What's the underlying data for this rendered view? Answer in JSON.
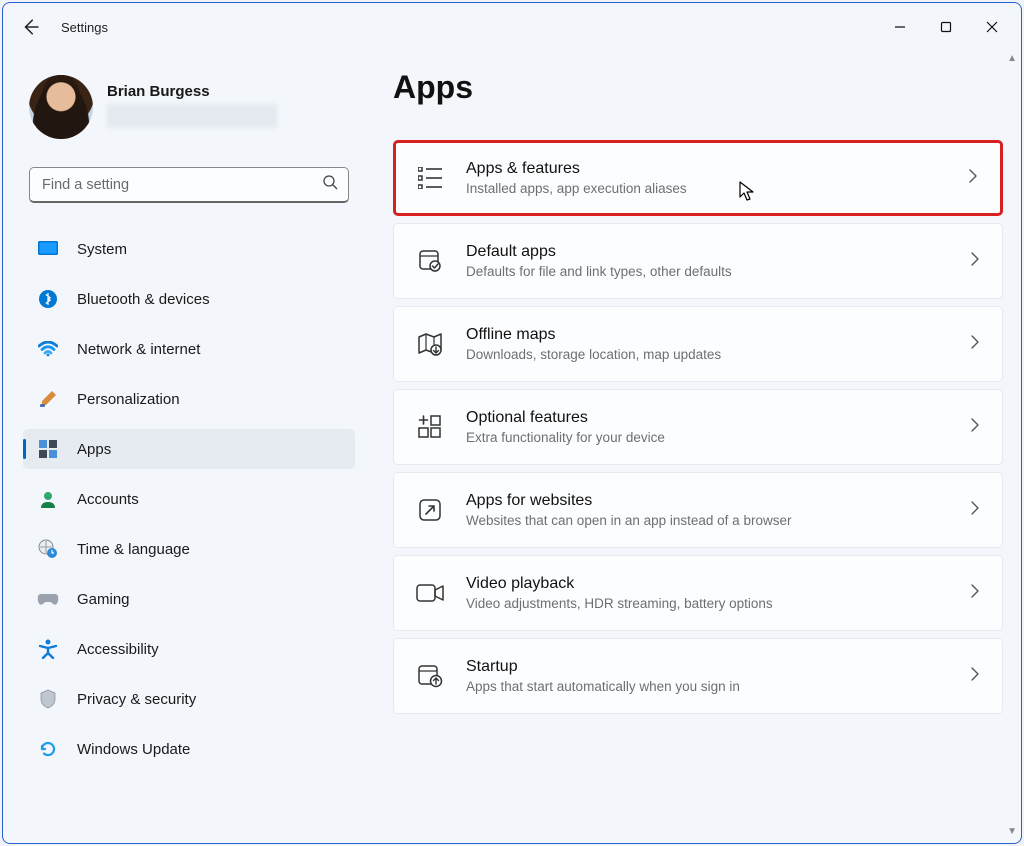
{
  "window": {
    "app_title": "Settings"
  },
  "profile": {
    "name": "Brian Burgess"
  },
  "search": {
    "placeholder": "Find a setting"
  },
  "sidebar": {
    "items": [
      {
        "label": "System"
      },
      {
        "label": "Bluetooth & devices"
      },
      {
        "label": "Network & internet"
      },
      {
        "label": "Personalization"
      },
      {
        "label": "Apps"
      },
      {
        "label": "Accounts"
      },
      {
        "label": "Time & language"
      },
      {
        "label": "Gaming"
      },
      {
        "label": "Accessibility"
      },
      {
        "label": "Privacy & security"
      },
      {
        "label": "Windows Update"
      }
    ],
    "selected_index": 4
  },
  "page": {
    "heading": "Apps",
    "cards": [
      {
        "title": "Apps & features",
        "sub": "Installed apps, app execution aliases",
        "highlighted": true
      },
      {
        "title": "Default apps",
        "sub": "Defaults for file and link types, other defaults"
      },
      {
        "title": "Offline maps",
        "sub": "Downloads, storage location, map updates"
      },
      {
        "title": "Optional features",
        "sub": "Extra functionality for your device"
      },
      {
        "title": "Apps for websites",
        "sub": "Websites that can open in an app instead of a browser"
      },
      {
        "title": "Video playback",
        "sub": "Video adjustments, HDR streaming, battery options"
      },
      {
        "title": "Startup",
        "sub": "Apps that start automatically when you sign in"
      }
    ]
  }
}
